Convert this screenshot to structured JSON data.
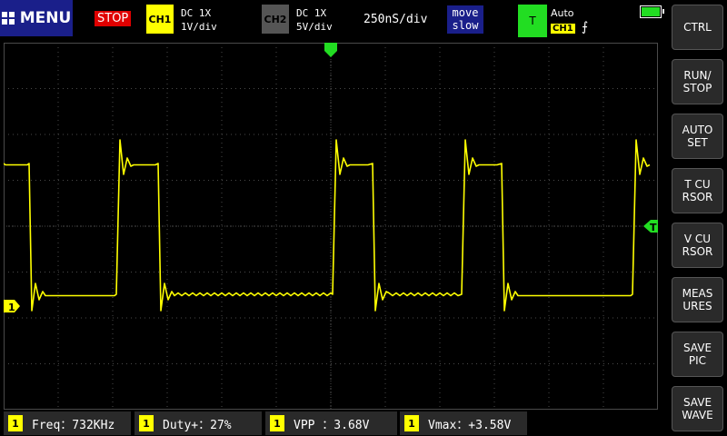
{
  "header": {
    "menu_label": "MENU",
    "run_state": "STOP",
    "ch1": {
      "badge": "CH1",
      "coupling": "DC  1X",
      "scale": "1V/div"
    },
    "ch2": {
      "badge": "CH2",
      "coupling": "DC  1X",
      "scale": "5V/div"
    },
    "timebase": "250nS/div",
    "move": {
      "line1": "move",
      "line2": "slow"
    },
    "trigger": {
      "badge": "T",
      "mode": "Auto",
      "source": "CH1",
      "edge_symbol": "⨍"
    }
  },
  "scope": {
    "ch1_marker": "1",
    "trigger_marker": "T",
    "colors": {
      "trace": "#ffff00",
      "grid": "#4a4a4a",
      "trigger": "#22dd22"
    }
  },
  "side_buttons": [
    {
      "label": "CTRL"
    },
    {
      "label": "RUN/\nSTOP"
    },
    {
      "label": "AUTO\nSET"
    },
    {
      "label": "T CU\nRSOR"
    },
    {
      "label": "V CU\nRSOR"
    },
    {
      "label": "MEAS\nURES"
    },
    {
      "label": "SAVE\nPIC"
    },
    {
      "label": "SAVE\nWAVE"
    }
  ],
  "measurements": [
    {
      "channel": "1",
      "text": "Freq：732KHz"
    },
    {
      "channel": "1",
      "text": "Duty+：27%"
    },
    {
      "channel": "1",
      "text": "VPP ：3.68V"
    },
    {
      "channel": "1",
      "text": "Vmax：+3.58V"
    }
  ]
}
